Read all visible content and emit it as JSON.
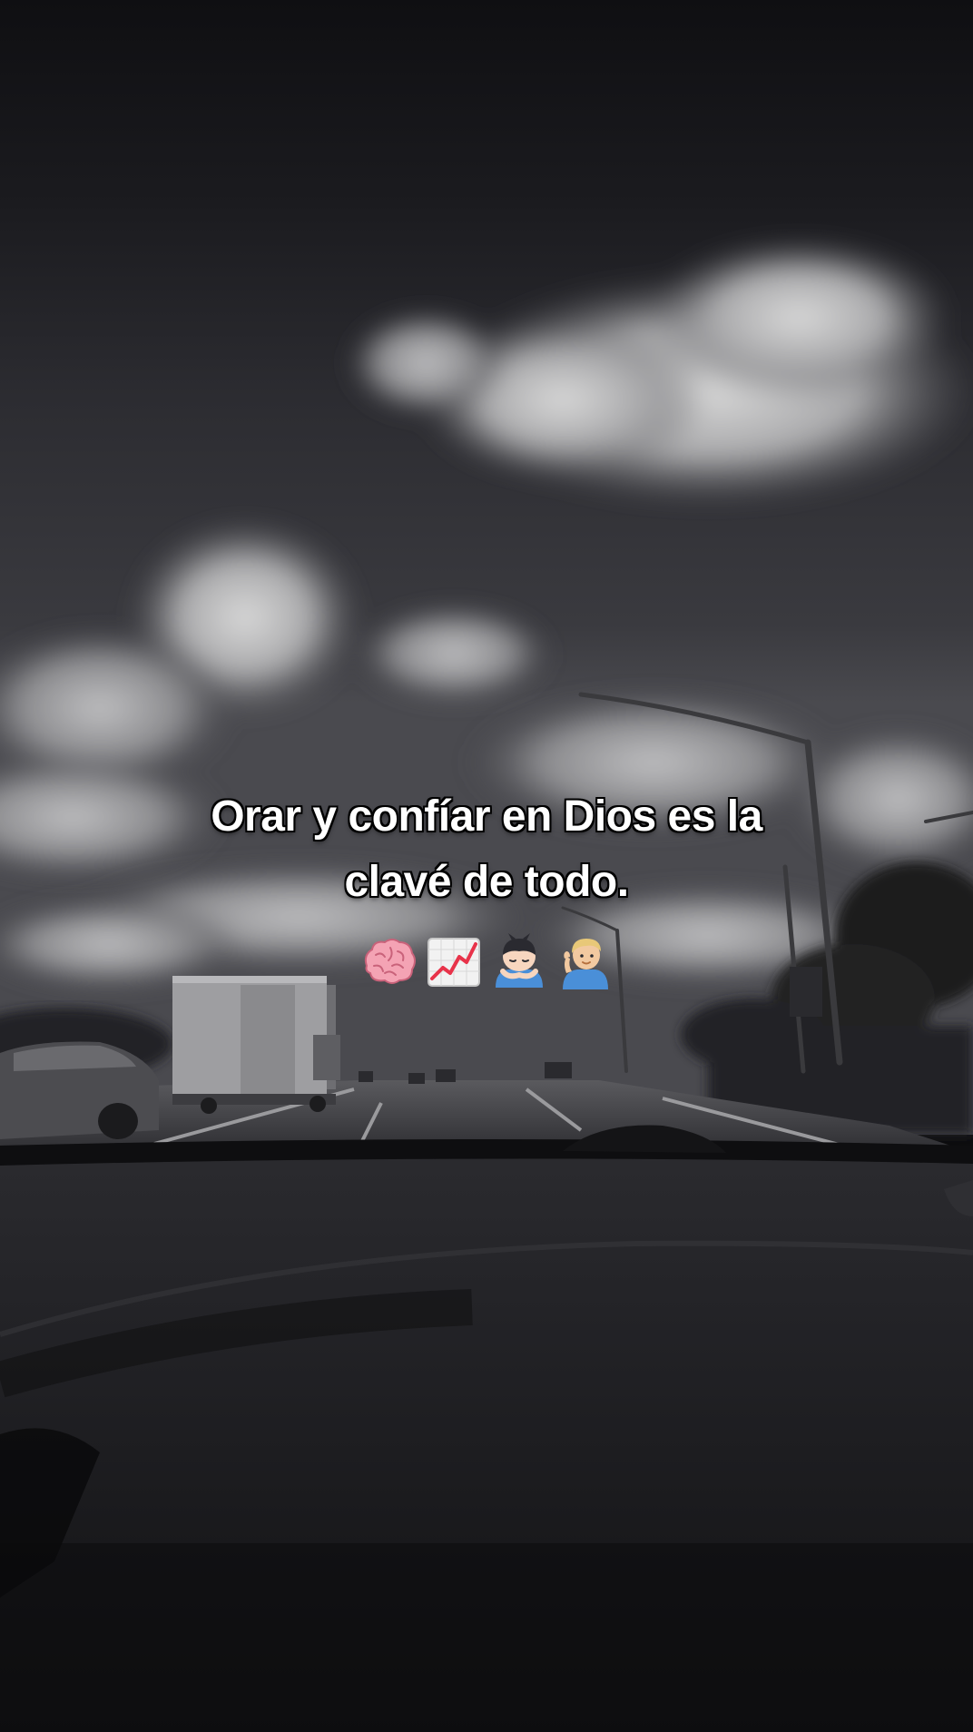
{
  "caption": {
    "line1": "Orar y confíar en Dios es la",
    "line2": "clavé de todo."
  },
  "emojis": [
    {
      "name": "brain-icon"
    },
    {
      "name": "chart-increasing-icon"
    },
    {
      "name": "person-bowing-icon"
    },
    {
      "name": "person-tipping-hand-icon"
    }
  ],
  "colors": {
    "caption_text": "#ffffff",
    "caption_outline": "#000000",
    "sky": "#2a2a2e",
    "dashboard": "#1a1a1d"
  }
}
